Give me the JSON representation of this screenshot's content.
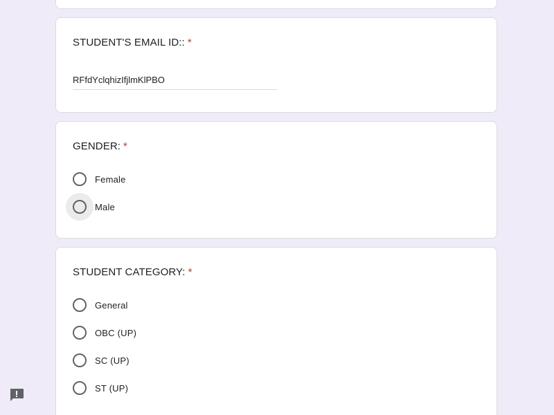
{
  "email_question": {
    "title": "STUDENT'S EMAIL ID::",
    "required_mark": "*",
    "answer": "RFfdYclqhizIfjlmKlPBO"
  },
  "gender_question": {
    "title": "GENDER:",
    "required_mark": "*",
    "options": [
      "Female",
      "Male"
    ]
  },
  "category_question": {
    "title": "STUDENT CATEGORY:",
    "required_mark": "*",
    "options": [
      "General",
      "OBC (UP)",
      "SC (UP)",
      "ST (UP)"
    ]
  },
  "colors": {
    "background": "#f0ebf8",
    "required": "#d93025",
    "radio_border": "#5f6368",
    "card_border": "#dadce0"
  },
  "icons": {
    "feedback": "report-feedback-icon"
  }
}
